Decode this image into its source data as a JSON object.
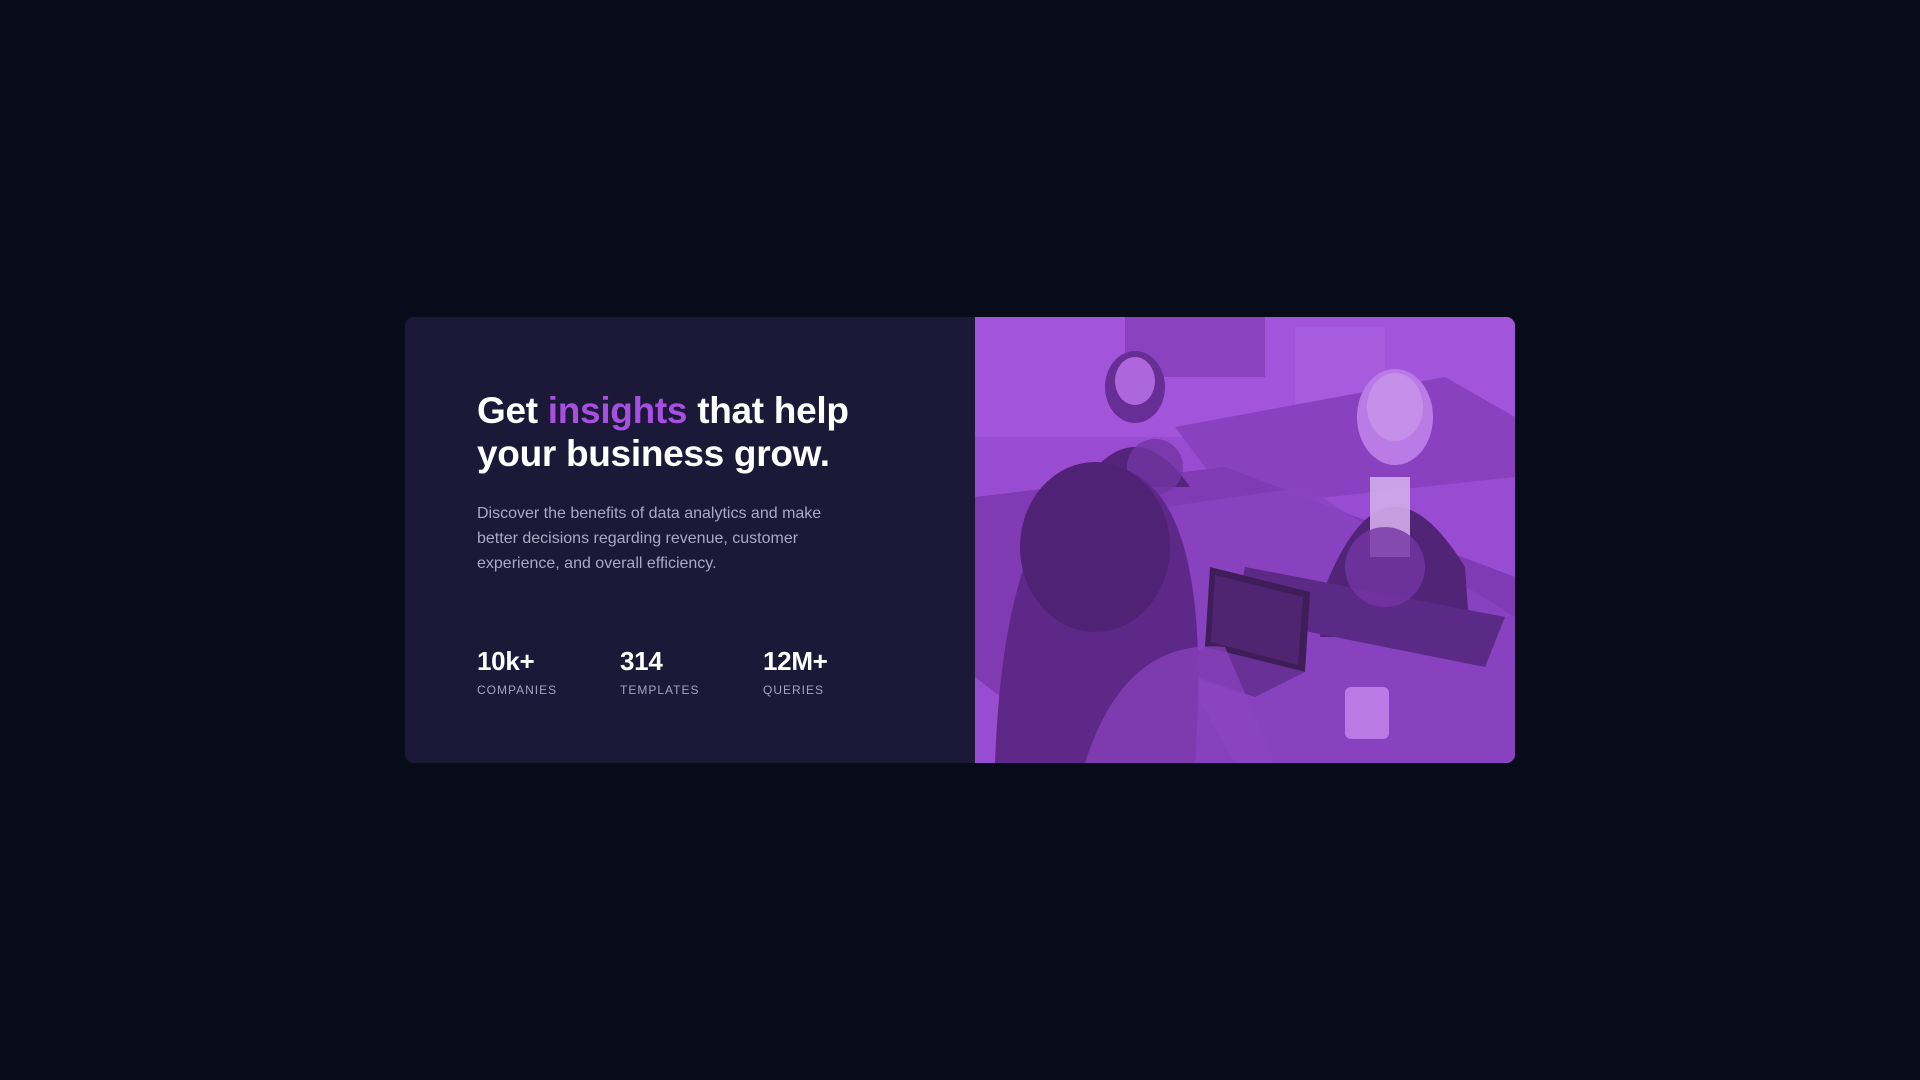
{
  "headline": {
    "part1": "Get ",
    "accent": "insights",
    "part2": " that help your business grow."
  },
  "description": "Discover the benefits of data analytics and make better decisions regarding revenue, customer experience, and overall efficiency.",
  "stats": [
    {
      "value": "10k+",
      "label": "COMPANIES"
    },
    {
      "value": "314",
      "label": "TEMPLATES"
    },
    {
      "value": "12M+",
      "label": "QUERIES"
    }
  ],
  "colors": {
    "page_background": "#080b1a",
    "card_background": "#1b1937",
    "accent": "#a64fe0",
    "photo_tint": "#8f44c8",
    "text_primary": "#ffffff",
    "text_muted": "#aca8c4"
  },
  "image": {
    "alt_icon": "team-meeting-photo"
  }
}
